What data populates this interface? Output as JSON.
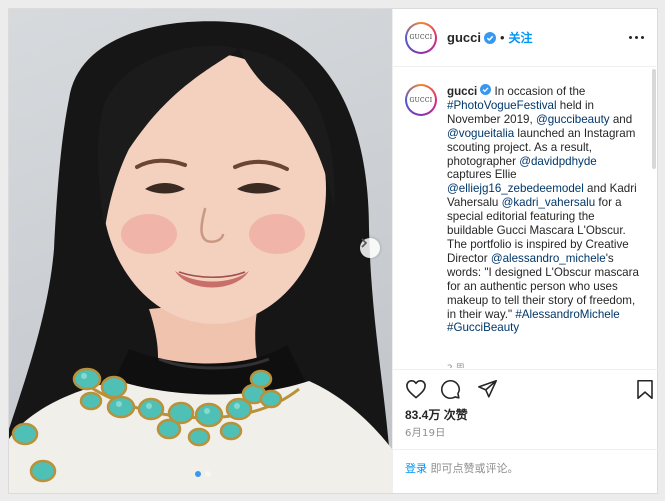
{
  "account": {
    "username": "gucci",
    "avatar_text": "GUCCI",
    "separator": "•",
    "follow_label": "关注"
  },
  "caption": {
    "username": "gucci",
    "text_1": " In occasion of the ",
    "hashtag_photovogue": "#PhotoVogueFestival",
    "text_2": " held in November 2019, ",
    "mention_guccibeauty": "@guccibeauty",
    "text_3": " and ",
    "mention_vogueitalia": "@vogueitalia",
    "text_4": " launched an Instagram scouting project. As a result, photographer ",
    "mention_davidpdhyde": "@davidpdhyde",
    "text_5": " captures Ellie ",
    "mention_elliejg16": "@elliejg16_zebedeemodel",
    "text_6": " and Kadri Vahersalu ",
    "mention_kadri": "@kadri_vahersalu",
    "text_7": " for a special editorial featuring the buildable Gucci Mascara L'Obscur. The portfolio is inspired by Creative Director ",
    "mention_alessandro": "@alessandro_michele",
    "text_8": "'s words: \"I designed L'Obscur mascara for an authentic person who uses makeup to tell their story of freedom, in their way.\" ",
    "hashtag_alessandro": "#AlessandroMichele",
    "text_9": " ",
    "hashtag_guccibeauty": "#GucciBeauty",
    "time_peek": "2 周"
  },
  "stats": {
    "likes": "83.4万 次赞",
    "date": "6月19日"
  },
  "footer": {
    "login_label": "登录",
    "login_prompt": " 即可点赞或评论。"
  },
  "icons": {
    "verified": "verified-badge-icon",
    "like": "heart-icon",
    "comment": "comment-icon",
    "share": "paper-plane-icon",
    "save": "bookmark-icon",
    "more": "more-options-icon",
    "next": "chevron-right-icon"
  },
  "colors": {
    "link": "#00376b",
    "follow": "#0095f6",
    "verified": "#3897f0",
    "muted": "#8e8e8e"
  },
  "carousel": {
    "slides": 2,
    "active_slide": 1
  }
}
